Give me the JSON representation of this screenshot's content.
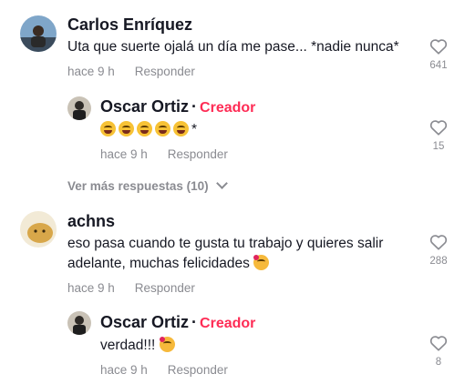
{
  "comments": [
    {
      "author": "Carlos Enríquez",
      "text": "Uta que suerte ojalá un día me pase... *nadie nunca*",
      "time": "hace 9 h",
      "reply_label": "Responder",
      "likes": "641",
      "avatar_icon": "user-photo"
    },
    {
      "author": "Oscar Ortiz",
      "separator": "·",
      "badge": "Creador",
      "text_suffix": "*",
      "emoji_count": 5,
      "emoji_icon": "tears-of-joy-emoji",
      "time": "hace 9 h",
      "reply_label": "Responder",
      "likes": "15"
    },
    {
      "author": "achns",
      "text_line1": "eso pasa cuando te gusta tu trabajo y quieres salir",
      "text_line2": "adelante, muchas felicidades",
      "emoji_icon": "smiling-face-with-hearts-emoji",
      "time": "hace 9 h",
      "reply_label": "Responder",
      "likes": "288"
    },
    {
      "author": "Oscar Ortiz",
      "separator": "·",
      "badge": "Creador",
      "text": "verdad!!!",
      "emoji_icon": "smiling-face-with-hearts-emoji",
      "time": "hace 9 h",
      "reply_label": "Responder",
      "likes": "8"
    }
  ],
  "more_replies_label": "Ver más respuestas (10)",
  "colors": {
    "creator_badge": "#fe2c55",
    "muted": "#8a8b91",
    "text": "#161823"
  }
}
